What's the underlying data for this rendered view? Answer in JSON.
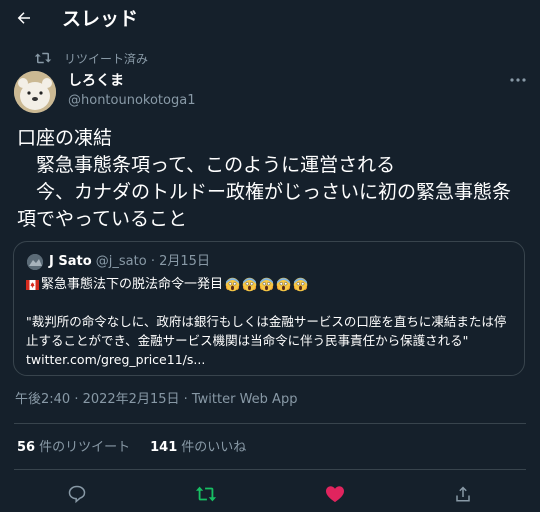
{
  "header": {
    "title": "スレッド"
  },
  "retweet_context": {
    "label": "リツイート済み"
  },
  "author": {
    "display_name": "しろくま",
    "handle": "@hontounokotoga1"
  },
  "tweet": {
    "text": "口座の凍結\n　緊急事態条項って、このように運営される\n　今、カナダのトルドー政権がじっさいに初の緊急事態条項でやっていること"
  },
  "quoted_tweet": {
    "name": "J Sato",
    "handle": "@j_sato",
    "date": "2月15日",
    "separator": "·",
    "line1": "緊急事態法下の脱法命令一発目",
    "body": "\"裁判所の命令なしに、政府は銀行もしくは金融サービスの口座を直ちに凍結または停止することができ、金融サービス機関は当命令に伴う民事責任から保護される\" twitter.com/greg_price11/s...",
    "flag_icon": "canada-flag-icon",
    "emoji_icon": "scream-emoji-icon",
    "emoji_count": 5
  },
  "meta": {
    "timestamp": "午後2:40 · 2022年2月15日 · Twitter Web App"
  },
  "stats": {
    "retweets_count": "56",
    "retweets_label": "件のリツイート",
    "likes_count": "141",
    "likes_label": "件のいいね"
  },
  "actions": {
    "reply_icon": "reply-icon",
    "retweet_icon": "retweet-icon",
    "like_icon": "heart-icon",
    "share_icon": "share-icon"
  },
  "colors": {
    "background": "#15202b",
    "muted": "#8899a6",
    "border": "#38444d",
    "retweet_active": "#17bf63",
    "like_active": "#e0245e"
  }
}
